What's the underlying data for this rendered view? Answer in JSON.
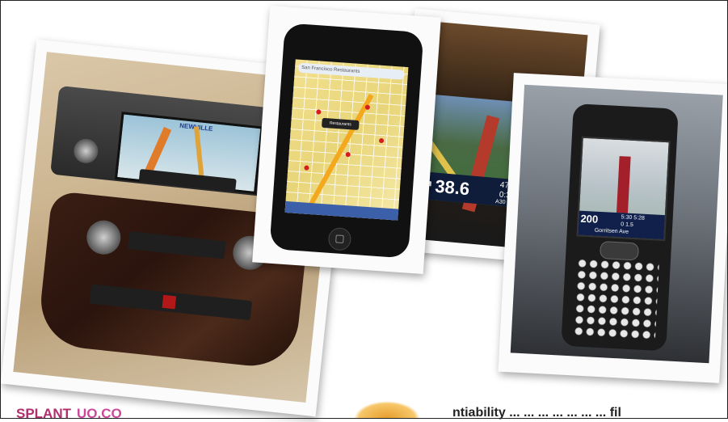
{
  "photos": {
    "car": {
      "screen_label": "NEWVILLE"
    },
    "iphone": {
      "search_text": "San Francisco Restaurants",
      "callout": "Restaurants"
    },
    "gps": {
      "arrow": "↗",
      "distance": "38.6",
      "time_top": "47.5",
      "time_bottom": "0:32",
      "road": "A30"
    },
    "treo": {
      "distance": "200",
      "time_top": "5:30",
      "time_top_right": "5:28",
      "dist_small": "0",
      "dist_small_right": "1.5",
      "street": "Gorritsen Ave"
    }
  },
  "footer": {
    "logo_left": "SPLANT",
    "logo_left_b": "UO.CO",
    "caption": "ntiability ... ...  ... ...   ...  ... ...  fil"
  },
  "colors": {
    "logo": "#b02e6e",
    "map_yellow": "#f2e08e",
    "gps_blue": "#0f1d3a"
  }
}
